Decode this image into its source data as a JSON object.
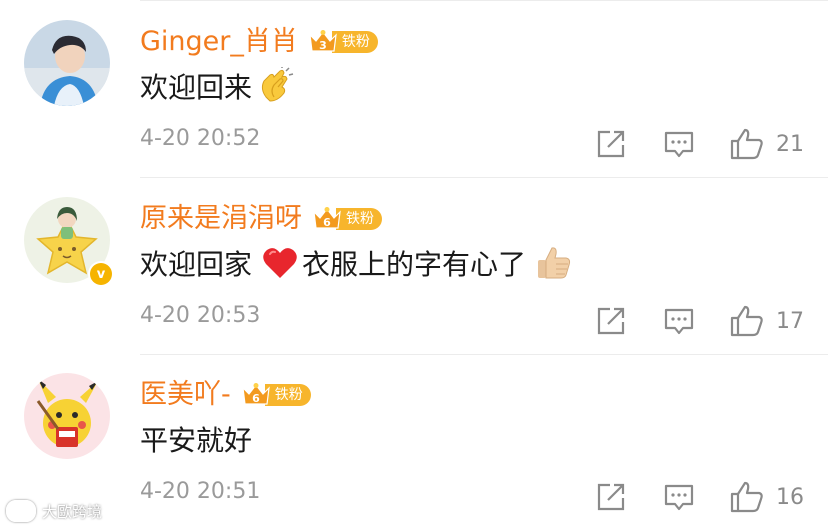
{
  "comments": [
    {
      "username": "Ginger_肖肖",
      "fan_level": "3",
      "fan_badge": "铁粉",
      "text": "欢迎回来",
      "text_emoji": "clapping-hands-emoji",
      "timestamp": "4-20 20:52",
      "likes": "21",
      "verified": false
    },
    {
      "username": "原来是涓涓呀",
      "fan_level": "6",
      "fan_badge": "铁粉",
      "text_before": "欢迎回家",
      "text_emoji": "red-heart-emoji",
      "text_after": "衣服上的字有心了",
      "text_emoji_2": "thumbs-up-emoji",
      "timestamp": "4-20 20:53",
      "likes": "17",
      "verified": true,
      "verified_mark": "v"
    },
    {
      "username": "医美吖-",
      "fan_level": "6",
      "fan_badge": "铁粉",
      "text": "平安就好",
      "timestamp": "4-20 20:51",
      "likes": "16",
      "verified": false
    }
  ],
  "watermark": {
    "text": "大歐跨境"
  },
  "colors": {
    "username": "#f27b1e",
    "fan_badge": "#f7b52c",
    "timestamp": "#9a9a9a",
    "action_icon": "#8a8a8a",
    "divider": "#ececec"
  }
}
